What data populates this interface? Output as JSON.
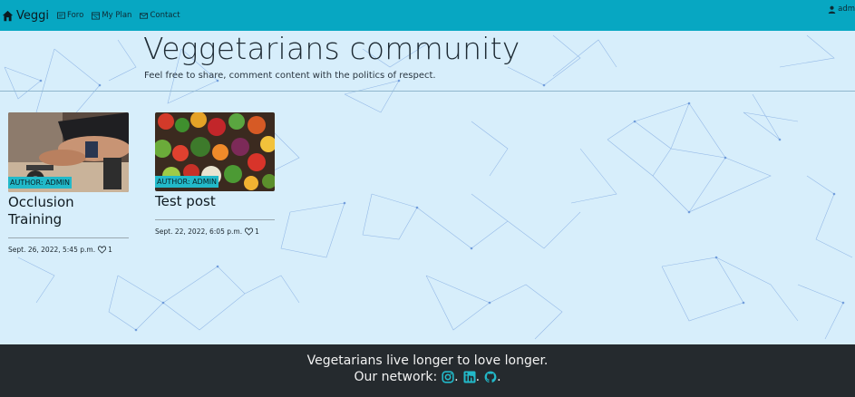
{
  "navbar": {
    "brand": "Veggi",
    "links": [
      {
        "label": "Foro",
        "icon": "chat-icon"
      },
      {
        "label": "My Plan",
        "icon": "calendar-icon"
      },
      {
        "label": "Contact",
        "icon": "envelope-icon"
      }
    ],
    "user": "adm",
    "accent": "#07a7c2"
  },
  "hero": {
    "title": "Veggetarians community",
    "subtitle": "Feel free to share, comment content with the politics of respect."
  },
  "posts": [
    {
      "author": "AUTHOR: ADMIN",
      "title": "Occlusion Training",
      "date": "Sept. 26, 2022, 5:45 p.m.",
      "likes": "1",
      "image": "gym-photo"
    },
    {
      "author": "AUTHOR: ADMIN",
      "title": "Test post",
      "date": "Sept. 22, 2022, 6:05 p.m.",
      "likes": "1",
      "image": "vegetables-photo"
    }
  ],
  "footer": {
    "tagline": "Vegetarians live longer to love longer.",
    "network_label": "Our network:",
    "network_icons": [
      "instagram-icon",
      "linkedin-icon",
      "github-icon"
    ],
    "icon_color": "#22b9c9",
    "background": "#252a2e"
  }
}
